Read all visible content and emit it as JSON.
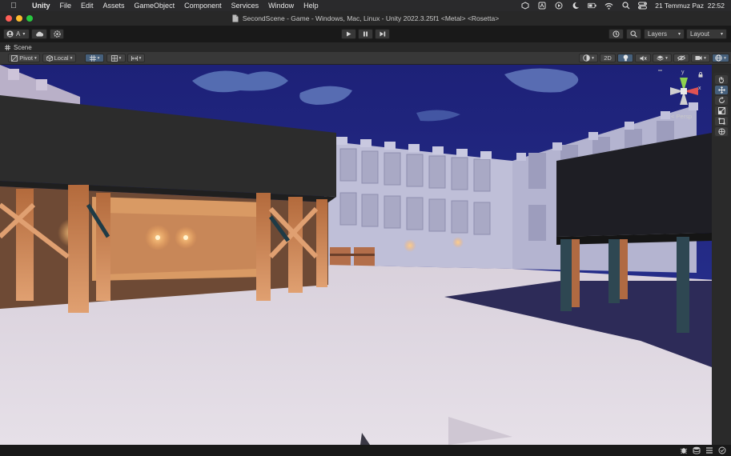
{
  "menubar": {
    "apple_icon": "apple-icon",
    "items": [
      "Unity",
      "File",
      "Edit",
      "Assets",
      "GameObject",
      "Component",
      "Services",
      "Window",
      "Help"
    ],
    "datetime": "21 Temmuz Paz  22:52"
  },
  "window": {
    "title": "SecondScene - Game - Windows, Mac, Linux - Unity 2022.3.25f1 <Metal> <Rosetta>"
  },
  "toolbar": {
    "account_label": "A",
    "layers_label": "Layers",
    "layout_label": "Layout"
  },
  "scene_tab": {
    "label": "Scene"
  },
  "scene_toolbar": {
    "pivot_label": "Pivot",
    "local_label": "Local",
    "mode_2d_label": "2D"
  },
  "gizmo": {
    "y_label": "y",
    "x_label": "x",
    "persp_label": "< Persp"
  },
  "colors": {
    "sky": "#1f2680",
    "accent": "#46607c",
    "editor_bg": "#191919"
  }
}
